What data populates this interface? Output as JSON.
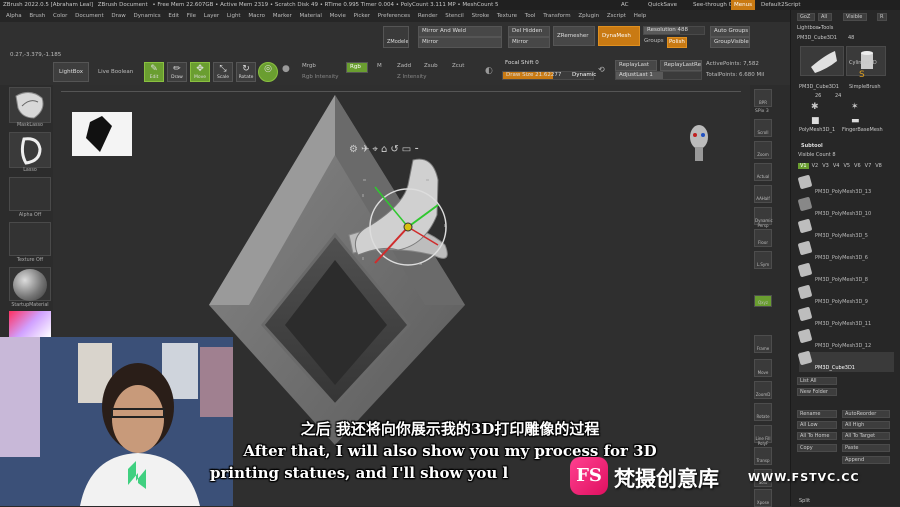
{
  "titlebar": {
    "app": "ZBrush 2022.0.5 [Abraham Leal]",
    "doc": "ZBrush Document",
    "stats": "• Free Mem 22.607GB • Active Mem 2319 • Scratch Disk 49 • RTime 0.995 Timer 0.004 • PolyCount 3.111 MP • MeshCount 5",
    "ac": "AC",
    "quicksave": "QuickSave",
    "seethrough": "See-through 0",
    "menus": "Menus",
    "script": "Default2Script"
  },
  "menubar": {
    "items": [
      "Alpha",
      "Brush",
      "Color",
      "Document",
      "Draw",
      "Dynamics",
      "Edit",
      "File",
      "Layer",
      "Light",
      "Macro",
      "Marker",
      "Material",
      "Movie",
      "Picker",
      "Preferences",
      "Render",
      "Stencil",
      "Stroke",
      "Texture",
      "Tool",
      "Transform",
      "Zplugin",
      "Zscript",
      "Help"
    ]
  },
  "coords": "0.27,-3.379,-1.185",
  "toolbar": {
    "lightbox": "LightBox",
    "live_boolean": "Live Boolean",
    "edit": "Edit",
    "draw": "Draw",
    "move": "Move",
    "scale": "Scale",
    "rotate": "Rotate",
    "mrgb": "Mrgb",
    "rgb": "Rgb",
    "m": "M",
    "zadd": "Zadd",
    "zsub": "Zsub",
    "zcut": "Zcut",
    "rgb_intensity": "Rgb Intensity",
    "z_intensity": "Z Intensity",
    "focal_shift": "Focal Shift 0",
    "draw_size": "Draw Size 21.62277",
    "dynamic": "Dynamic",
    "replay_last": "ReplayLast",
    "replay_last_rel": "ReplayLastRel",
    "adjust_last": "AdjustLast 1",
    "active_points": "ActivePoints: 7,582",
    "total_points": "TotalPoints: 6.680 Mil",
    "zmodeler": "ZModeler",
    "mirror_and_weld": "Mirror And Weld",
    "mirror": "Mirror",
    "del_hidden": "Del Hidden",
    "mirror2": "Mirror",
    "zremesher": "ZRemesher",
    "dynamesh": "DynaMesh",
    "resolution": "Resolution 488",
    "groups": "Groups",
    "polish": "Polish",
    "auto_groups": "Auto Groups",
    "group_visible": "GroupVisible"
  },
  "progress": {
    "focal_shift": 0.5,
    "draw_size": 0.55
  },
  "leftshelf": {
    "brush_label": "MaskLasso",
    "stroke_label": "Lasso",
    "alpha_label": "Alpha Off",
    "texture_label": "Texture Off",
    "material_label": "StartupMaterial"
  },
  "rightshelf": {
    "items": [
      "BPR",
      "SPix 3",
      "Scroll",
      "Zoom",
      "Actual",
      "AAHalf",
      "Dynamic Persp",
      "Floor",
      "L.Sym",
      "Qxyz",
      "Frame",
      "Move",
      "ZoomD",
      "Rotate",
      "Line Fill PolyF",
      "Transp",
      "Solo",
      "Xpose"
    ]
  },
  "tray": {
    "goz": "GoZ",
    "all": "All",
    "visible": "Visible",
    "r": "R",
    "lightbox_tools": "Lightbox▸Tools",
    "current_tool": "PM3D_Cube3D1",
    "current_count": "48",
    "tools": [
      "PM3D_Cube3D1",
      "Cylinder3D",
      "SimpleBrush",
      "PolyMesh3D",
      "PolyMesh3D_1",
      "FingerBaseMesh"
    ],
    "tool_counts": [
      "26",
      "24"
    ],
    "subtool_header": "Subtool",
    "visible_count": "Visible Count 8",
    "v_tabs": [
      "V1",
      "V2",
      "V3",
      "V4",
      "V5",
      "V6",
      "V7",
      "V8"
    ],
    "subtools": [
      "PM3D_PolyMesh3D_13",
      "PM3D_PolyMesh3D_10",
      "PM3D_PolyMesh3D_5",
      "PM3D_PolyMesh3D_6",
      "PM3D_PolyMesh3D_8",
      "PM3D_PolyMesh3D_9",
      "PM3D_PolyMesh3D_11",
      "PM3D_PolyMesh3D_12",
      "PM3D_Cube3D1"
    ],
    "list_all": "List All",
    "new_folder": "New Folder",
    "rename": "Rename",
    "auto_reorder": "AutoReorder",
    "all_low": "All Low",
    "all_high": "All High",
    "all_to_home": "All To Home",
    "all_to_target": "All To Target",
    "copy": "Copy",
    "paste": "Paste",
    "append": "Append",
    "split": "Split"
  },
  "subtitles": {
    "zh": "之后 我还将向你展示我的3D打印雕像的过程",
    "en1": "After that, I will also show you my process for 3D",
    "en2": "printing statues, and I'll show you l"
  },
  "watermark": {
    "logo": "FS",
    "cn": "梵摄创意库",
    "url": "WWW.FSTVC.CC"
  },
  "colors": {
    "accent_orange": "#c97a13",
    "accent_green": "#6a9e30",
    "dynamesh_orange": "#d68a1a"
  }
}
